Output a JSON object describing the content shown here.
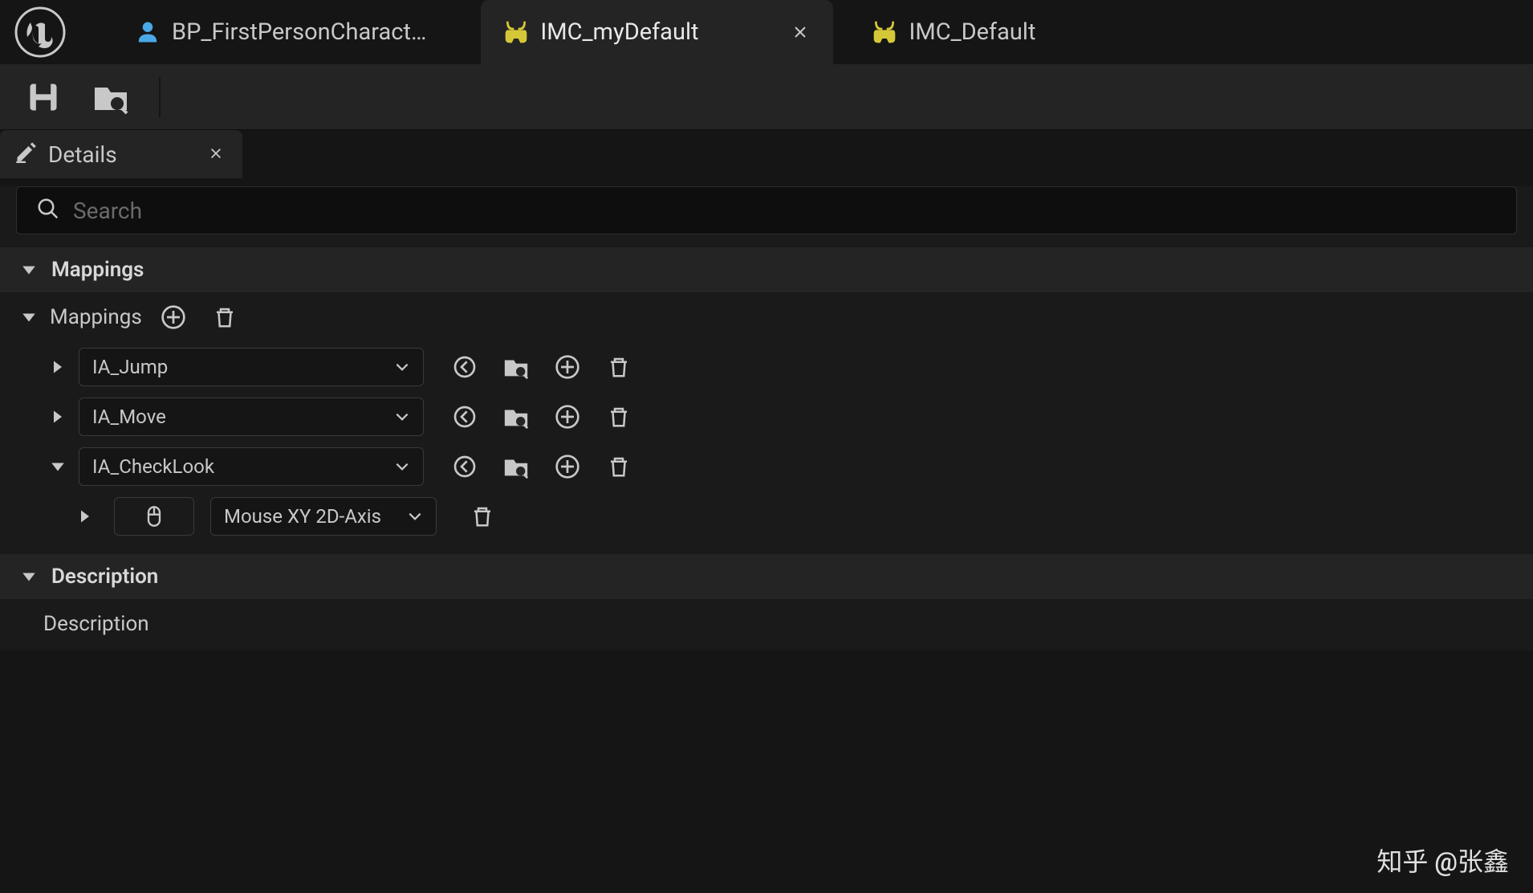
{
  "tabs": [
    {
      "label": "BP_FirstPersonCharact…",
      "active": false,
      "icon": "person"
    },
    {
      "label": "IMC_myDefault",
      "active": true,
      "icon": "controller",
      "closable": true
    },
    {
      "label": "IMC_Default",
      "active": false,
      "icon": "controller"
    }
  ],
  "panel": {
    "title": "Details"
  },
  "search": {
    "placeholder": "Search"
  },
  "sections": {
    "mappings_header": "Mappings",
    "mappings_label": "Mappings",
    "actions": [
      {
        "name": "IA_Jump",
        "expanded": false
      },
      {
        "name": "IA_Move",
        "expanded": false
      },
      {
        "name": "IA_CheckLook",
        "expanded": true,
        "bindings": [
          {
            "key": "Mouse XY 2D-Axis",
            "icon": "mouse"
          }
        ]
      }
    ],
    "description_header": "Description",
    "description_label": "Description"
  },
  "watermark": "知乎 @张鑫"
}
